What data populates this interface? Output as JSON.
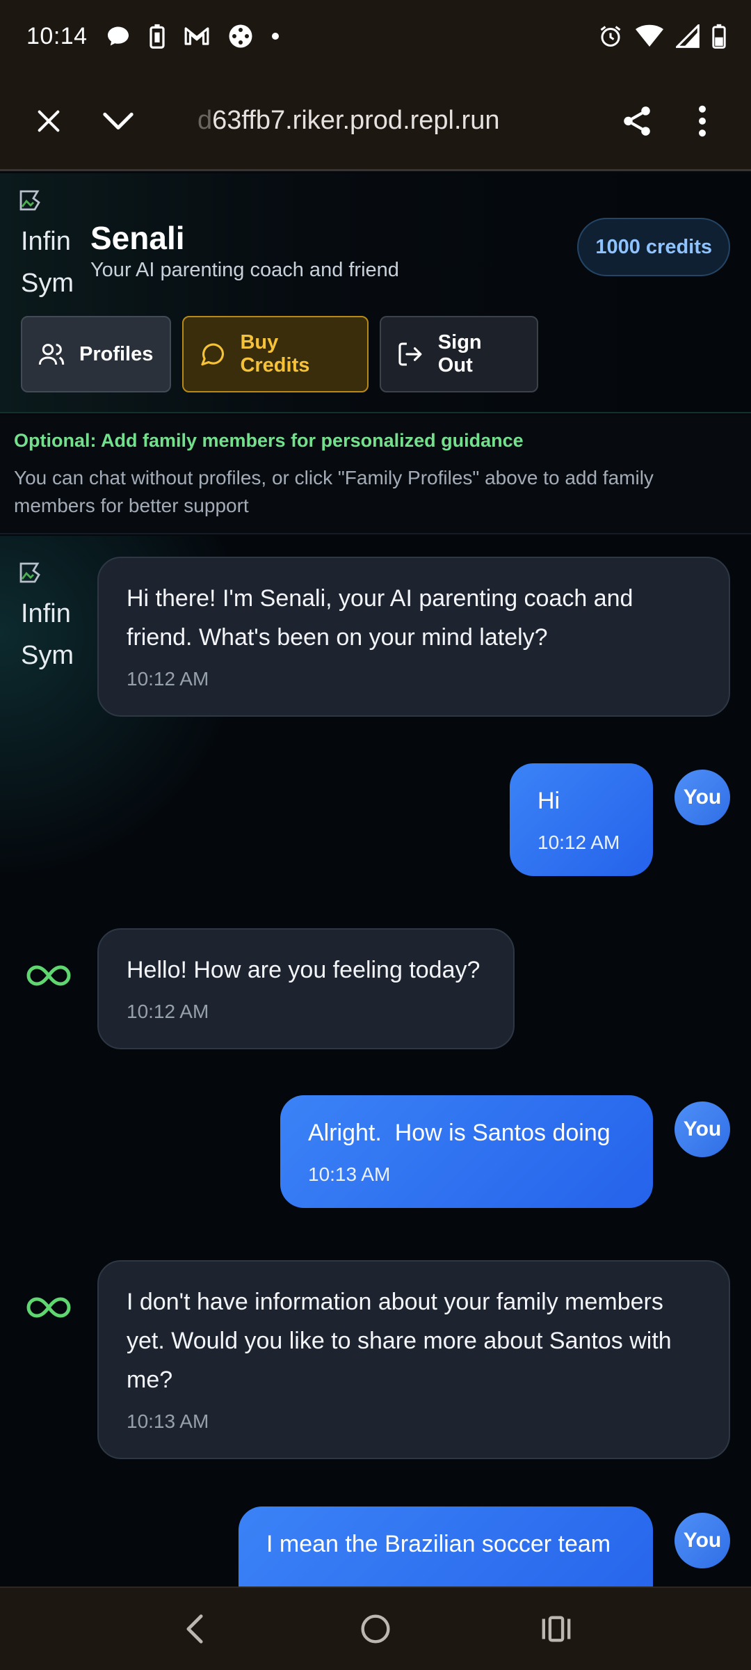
{
  "status_bar": {
    "time": "10:14",
    "icons": [
      "chat-bubble-icon",
      "battery-saver-icon",
      "gmail-icon",
      "game-icon",
      "dot-icon",
      "alarm-icon",
      "wifi-icon",
      "signal-icon",
      "battery-icon"
    ]
  },
  "browser": {
    "url_faded": "d",
    "url": "63ffb7.riker.prod.repl.run",
    "icons": [
      "close-icon",
      "chevron-down-icon",
      "share-icon",
      "more-vert-icon"
    ]
  },
  "header": {
    "logo_alt": "Infin Sym",
    "title": "Senali",
    "subtitle": "Your AI parenting coach and friend",
    "credits": "1000 credits",
    "buttons": {
      "profiles": "Profiles",
      "buy_credits": "Buy Credits",
      "sign_out": "Sign Out"
    }
  },
  "notice": {
    "title": "Optional: Add family members for personalized guidance",
    "body": "You can chat without profiles, or click \"Family Profiles\" above to add family members for better support"
  },
  "chat": {
    "ai_avatar_alt": "Infin Sym",
    "user_avatar_label": "You",
    "messages": [
      {
        "sender": "ai",
        "text": "Hi there! I'm Senali, your AI parenting coach and friend. What's been on your mind lately?",
        "time": "10:12 AM"
      },
      {
        "sender": "user",
        "text": "Hi",
        "time": "10:12 AM"
      },
      {
        "sender": "ai",
        "text": "Hello! How are you feeling today?",
        "time": "10:12 AM"
      },
      {
        "sender": "user",
        "text": "Alright.  How is Santos doing",
        "time": "10:13 AM"
      },
      {
        "sender": "ai",
        "text": "I don't have information about your family members yet. Would you like to share more about Santos with me?",
        "time": "10:13 AM"
      },
      {
        "sender": "user",
        "text": "I mean the Brazilian soccer team",
        "time": ""
      }
    ]
  },
  "nav_bar": {
    "icons": [
      "back-icon",
      "home-icon",
      "recents-icon"
    ]
  },
  "colors": {
    "accent_blue": "#3b82f6",
    "accent_green": "#74e08e",
    "accent_gold": "#f6c338",
    "credits_text": "#8fc3ff"
  }
}
